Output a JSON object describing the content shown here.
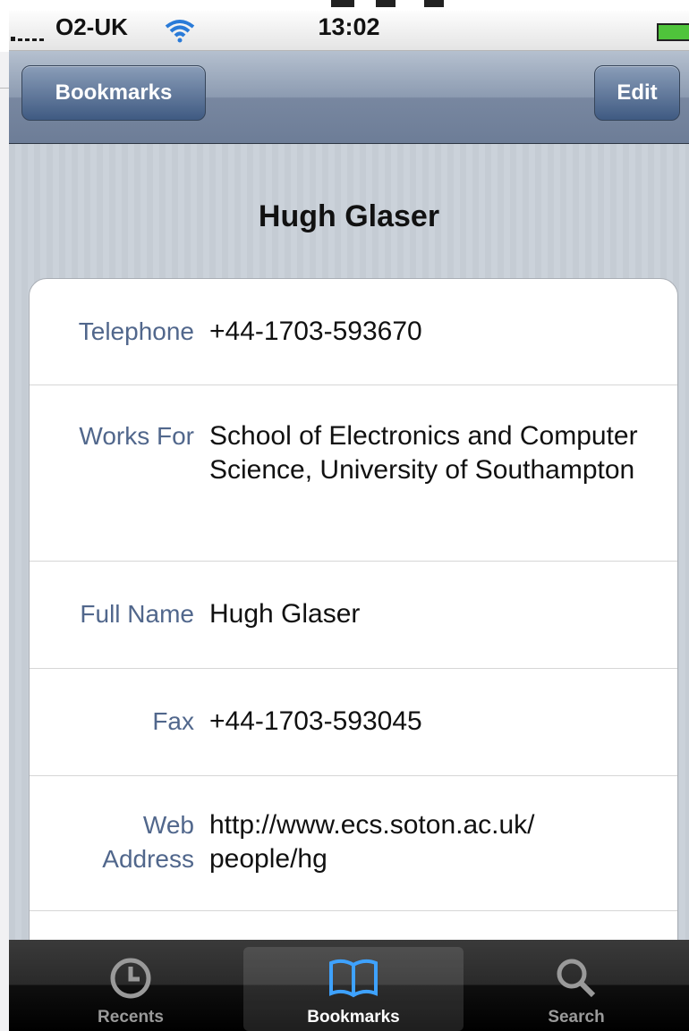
{
  "status": {
    "carrier": "O2-UK",
    "time": "13:02"
  },
  "navbar": {
    "back_label": "Bookmarks",
    "edit_label": "Edit"
  },
  "detail": {
    "title": "Hugh Glaser",
    "rows": [
      {
        "label": "Telephone",
        "value": "+44-1703-593670"
      },
      {
        "label": "Works For",
        "value": "School of Electronics and Computer Science, University of Southampton"
      },
      {
        "label": "Full Name",
        "value": "Hugh Glaser"
      },
      {
        "label": "Fax",
        "value": "+44-1703-593045"
      },
      {
        "label": "Web\nAddress",
        "value": "http://www.ecs.soton.ac.uk/\npeople/hg"
      }
    ]
  },
  "tabbar": {
    "tabs": [
      {
        "label": "Recents",
        "icon": "clock-icon",
        "active": false
      },
      {
        "label": "Bookmarks",
        "icon": "book-icon",
        "active": true
      },
      {
        "label": "Search",
        "icon": "search-icon",
        "active": false
      }
    ]
  },
  "colors": {
    "label_blue": "#51678c",
    "nav_blue": "#6d7d97",
    "battery_green": "#4fc43b"
  }
}
